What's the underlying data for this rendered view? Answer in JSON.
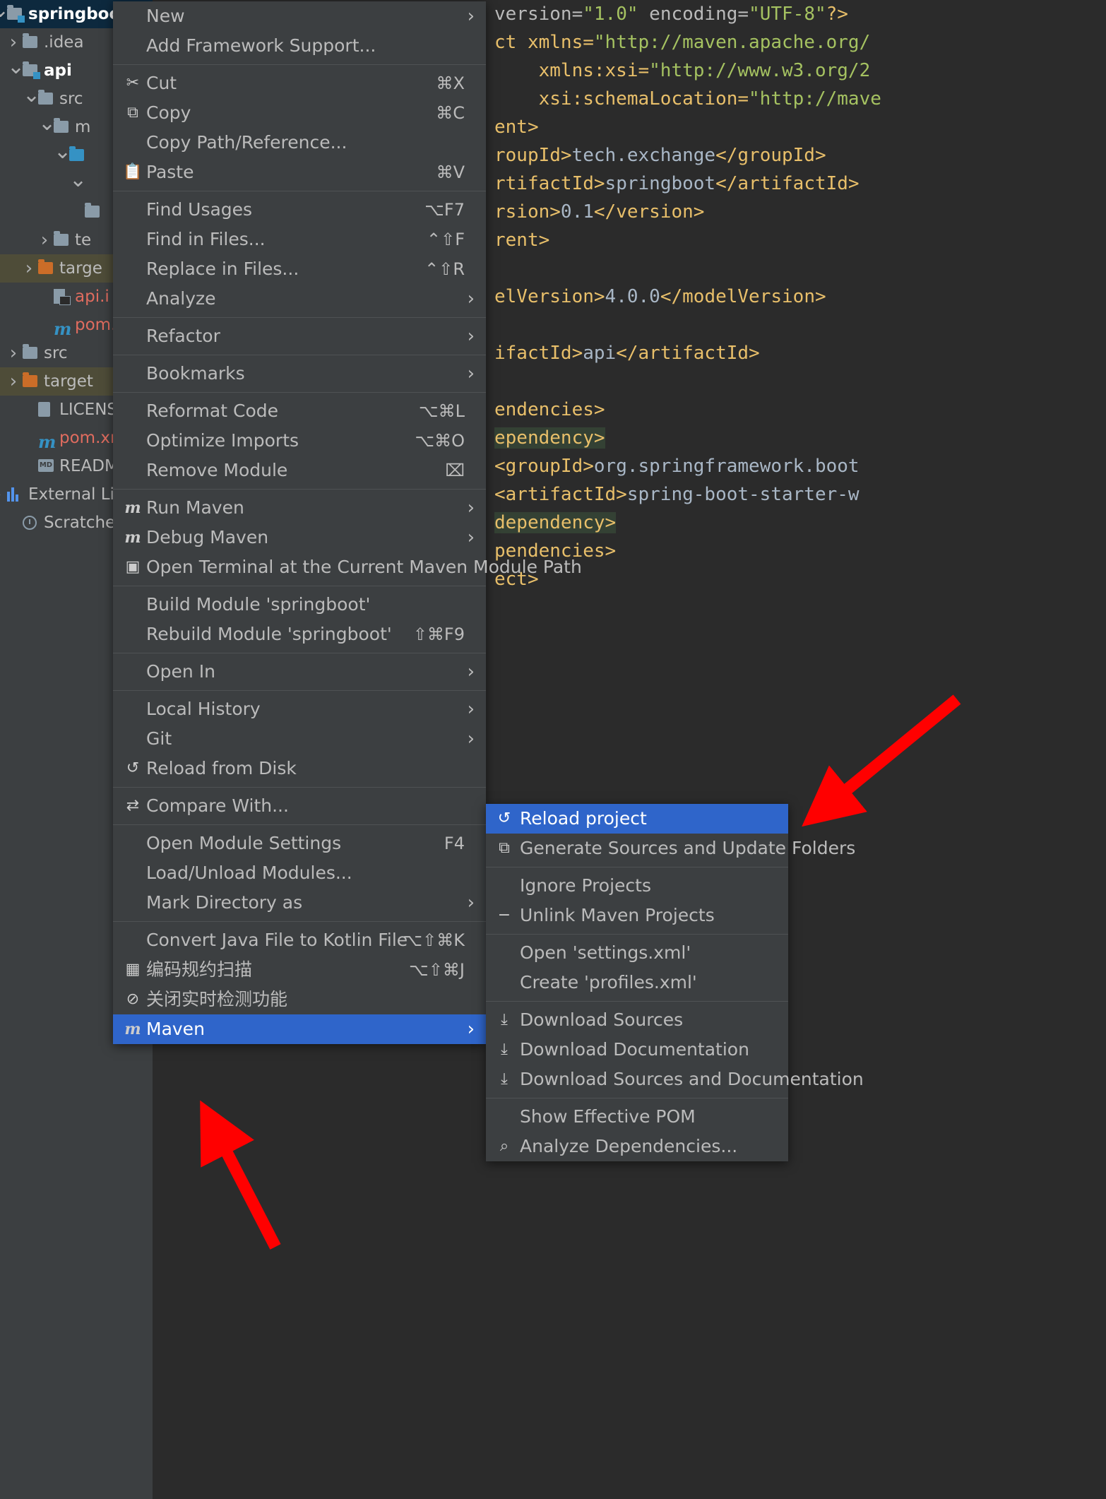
{
  "app": {
    "theme_bg": "#3c3f41",
    "editor_bg": "#2b2b2b",
    "accent": "#2f65ca",
    "annotation_color": "#ff0000"
  },
  "sidebar": {
    "items": [
      {
        "label": "springboot",
        "icon": "module-folder-icon",
        "indent": 0,
        "arrow": "v",
        "state": "selected-blue",
        "bold": true
      },
      {
        "label": ".idea",
        "icon": "folder-icon",
        "indent": 1,
        "arrow": ">",
        "state": "",
        "bold": false
      },
      {
        "label": "api",
        "icon": "module-folder-icon",
        "indent": 1,
        "arrow": "v",
        "state": "",
        "bold": true
      },
      {
        "label": "src",
        "icon": "folder-icon",
        "indent": 2,
        "arrow": "v",
        "state": "",
        "bold": false
      },
      {
        "label": "m",
        "icon": "folder-icon",
        "indent": 3,
        "arrow": "v",
        "state": "",
        "bold": false
      },
      {
        "label": "",
        "icon": "source-folder-icon",
        "indent": 4,
        "arrow": "v",
        "state": "",
        "bold": false
      },
      {
        "label": "",
        "icon": "",
        "indent": 5,
        "arrow": "v",
        "state": "",
        "bold": false
      },
      {
        "label": "",
        "icon": "folder-icon",
        "indent": 5,
        "arrow": "",
        "state": "",
        "bold": false
      },
      {
        "label": "te",
        "icon": "folder-icon",
        "indent": 3,
        "arrow": ">",
        "state": "",
        "bold": false
      },
      {
        "label": "targe",
        "icon": "excluded-folder-icon",
        "indent": 2,
        "arrow": ">",
        "state": "selected-olive",
        "bold": false
      },
      {
        "label": "api.i",
        "icon": "iml-file-icon",
        "indent": 3,
        "arrow": "",
        "state": "",
        "bold": false,
        "color": "red"
      },
      {
        "label": "pom.",
        "icon": "maven-file-icon",
        "indent": 3,
        "arrow": "",
        "state": "",
        "bold": false,
        "color": "red"
      },
      {
        "label": "src",
        "icon": "folder-icon",
        "indent": 1,
        "arrow": ">",
        "state": "",
        "bold": false
      },
      {
        "label": "target",
        "icon": "excluded-folder-icon",
        "indent": 1,
        "arrow": ">",
        "state": "selected-olive",
        "bold": false
      },
      {
        "label": "LICENSE",
        "icon": "file-icon",
        "indent": 2,
        "arrow": "",
        "state": "",
        "bold": false
      },
      {
        "label": "pom.xm",
        "icon": "maven-file-icon",
        "indent": 2,
        "arrow": "",
        "state": "",
        "bold": false,
        "color": "red"
      },
      {
        "label": "README",
        "icon": "markdown-file-icon",
        "indent": 2,
        "arrow": "",
        "state": "",
        "bold": false
      },
      {
        "label": "External Li",
        "icon": "library-icon",
        "indent": 0,
        "arrow": ">",
        "state": "",
        "bold": false
      },
      {
        "label": "Scratches a",
        "icon": "scratches-icon",
        "indent": 1,
        "arrow": "",
        "state": "",
        "bold": false
      }
    ]
  },
  "editor": {
    "lines": [
      {
        "segments": [
          {
            "t": "version=",
            "c": "attr"
          },
          {
            "t": "\"1.0\"",
            "c": "str"
          },
          {
            "t": " encoding=",
            "c": "attr"
          },
          {
            "t": "\"UTF-8\"",
            "c": "str"
          },
          {
            "t": "?>",
            "c": "tag"
          }
        ]
      },
      {
        "segments": [
          {
            "t": "ct xmlns=",
            "c": "tag"
          },
          {
            "t": "\"http://maven.apache.org/",
            "c": "str"
          }
        ]
      },
      {
        "segments": [
          {
            "t": "    xmlns:xsi=",
            "c": "tag"
          },
          {
            "t": "\"http://www.w3.org/2",
            "c": "str"
          }
        ]
      },
      {
        "segments": [
          {
            "t": "    xsi:schemaLocation=",
            "c": "tag"
          },
          {
            "t": "\"http://mave",
            "c": "str"
          }
        ]
      },
      {
        "segments": [
          {
            "t": "ent>",
            "c": "tag"
          }
        ]
      },
      {
        "segments": [
          {
            "t": "roupId>",
            "c": "tag"
          },
          {
            "t": "tech.exchange",
            "c": "txt"
          },
          {
            "t": "</groupId>",
            "c": "tag"
          }
        ]
      },
      {
        "segments": [
          {
            "t": "rtifactId>",
            "c": "tag"
          },
          {
            "t": "springboot",
            "c": "txt"
          },
          {
            "t": "</artifactId>",
            "c": "tag"
          }
        ]
      },
      {
        "segments": [
          {
            "t": "rsion>",
            "c": "tag"
          },
          {
            "t": "0.1",
            "c": "txt"
          },
          {
            "t": "</version>",
            "c": "tag"
          }
        ]
      },
      {
        "segments": [
          {
            "t": "rent>",
            "c": "tag"
          }
        ]
      },
      {
        "segments": []
      },
      {
        "segments": [
          {
            "t": "elVersion>",
            "c": "tag"
          },
          {
            "t": "4.0.0",
            "c": "txt"
          },
          {
            "t": "</modelVersion>",
            "c": "tag"
          }
        ]
      },
      {
        "segments": []
      },
      {
        "segments": [
          {
            "t": "ifactId>",
            "c": "tag"
          },
          {
            "t": "api",
            "c": "txt"
          },
          {
            "t": "</artifactId>",
            "c": "tag"
          }
        ]
      },
      {
        "segments": []
      },
      {
        "segments": [
          {
            "t": "endencies>",
            "c": "tag"
          }
        ]
      },
      {
        "segments": [
          {
            "t": "ependency>",
            "c": "tag",
            "hl": true
          }
        ]
      },
      {
        "segments": [
          {
            "t": "<groupId>",
            "c": "tag"
          },
          {
            "t": "org.springframework.boot",
            "c": "txt"
          }
        ]
      },
      {
        "segments": [
          {
            "t": "<artifactId>",
            "c": "tag"
          },
          {
            "t": "spring-boot-starter-w",
            "c": "txt"
          }
        ]
      },
      {
        "segments": [
          {
            "t": "dependency>",
            "c": "tag",
            "hl": true
          }
        ]
      },
      {
        "segments": [
          {
            "t": "pendencies>",
            "c": "tag"
          }
        ]
      },
      {
        "segments": [
          {
            "t": "ect>",
            "c": "tag"
          }
        ]
      }
    ]
  },
  "context_menu": {
    "groups": [
      {
        "items": [
          {
            "label": "New",
            "shortcut": "",
            "submenu": true,
            "icon": ""
          },
          {
            "label": "Add Framework Support...",
            "shortcut": "",
            "submenu": false,
            "icon": ""
          }
        ]
      },
      {
        "items": [
          {
            "label": "Cut",
            "shortcut": "⌘X",
            "submenu": false,
            "icon": "scissors-icon"
          },
          {
            "label": "Copy",
            "shortcut": "⌘C",
            "submenu": false,
            "icon": "copy-icon"
          },
          {
            "label": "Copy Path/Reference...",
            "shortcut": "",
            "submenu": false,
            "icon": ""
          },
          {
            "label": "Paste",
            "shortcut": "⌘V",
            "submenu": false,
            "icon": "clipboard-icon"
          }
        ]
      },
      {
        "items": [
          {
            "label": "Find Usages",
            "shortcut": "⌥F7",
            "submenu": false,
            "icon": ""
          },
          {
            "label": "Find in Files...",
            "shortcut": "⌃⇧F",
            "submenu": false,
            "icon": ""
          },
          {
            "label": "Replace in Files...",
            "shortcut": "⌃⇧R",
            "submenu": false,
            "icon": ""
          },
          {
            "label": "Analyze",
            "shortcut": "",
            "submenu": true,
            "icon": ""
          }
        ]
      },
      {
        "items": [
          {
            "label": "Refactor",
            "shortcut": "",
            "submenu": true,
            "icon": ""
          }
        ]
      },
      {
        "items": [
          {
            "label": "Bookmarks",
            "shortcut": "",
            "submenu": true,
            "icon": ""
          }
        ]
      },
      {
        "items": [
          {
            "label": "Reformat Code",
            "shortcut": "⌥⌘L",
            "submenu": false,
            "icon": ""
          },
          {
            "label": "Optimize Imports",
            "shortcut": "⌥⌘O",
            "submenu": false,
            "icon": ""
          },
          {
            "label": "Remove Module",
            "shortcut": "⌧",
            "submenu": false,
            "icon": ""
          }
        ]
      },
      {
        "items": [
          {
            "label": "Run Maven",
            "shortcut": "",
            "submenu": true,
            "icon": "maven-icon"
          },
          {
            "label": "Debug Maven",
            "shortcut": "",
            "submenu": true,
            "icon": "maven-debug-icon"
          },
          {
            "label": "Open Terminal at the Current Maven Module Path",
            "shortcut": "",
            "submenu": false,
            "icon": "terminal-icon"
          }
        ]
      },
      {
        "items": [
          {
            "label": "Build Module 'springboot'",
            "shortcut": "",
            "submenu": false,
            "icon": ""
          },
          {
            "label": "Rebuild Module 'springboot'",
            "shortcut": "⇧⌘F9",
            "submenu": false,
            "icon": ""
          }
        ]
      },
      {
        "items": [
          {
            "label": "Open In",
            "shortcut": "",
            "submenu": true,
            "icon": ""
          }
        ]
      },
      {
        "items": [
          {
            "label": "Local History",
            "shortcut": "",
            "submenu": true,
            "icon": ""
          },
          {
            "label": "Git",
            "shortcut": "",
            "submenu": true,
            "icon": ""
          },
          {
            "label": "Reload from Disk",
            "shortcut": "",
            "submenu": false,
            "icon": "reload-icon"
          }
        ]
      },
      {
        "items": [
          {
            "label": "Compare With...",
            "shortcut": "",
            "submenu": false,
            "icon": "compare-icon"
          }
        ]
      },
      {
        "items": [
          {
            "label": "Open Module Settings",
            "shortcut": "F4",
            "submenu": false,
            "icon": ""
          },
          {
            "label": "Load/Unload Modules...",
            "shortcut": "",
            "submenu": false,
            "icon": ""
          },
          {
            "label": "Mark Directory as",
            "shortcut": "",
            "submenu": true,
            "icon": ""
          }
        ]
      },
      {
        "items": [
          {
            "label": "Convert Java File to Kotlin File",
            "shortcut": "⌥⇧⌘K",
            "submenu": false,
            "icon": ""
          },
          {
            "label": "编码规约扫描",
            "shortcut": "⌥⇧⌘J",
            "submenu": false,
            "icon": "scan-icon"
          },
          {
            "label": "关闭实时检测功能",
            "shortcut": "",
            "submenu": false,
            "icon": "disable-icon"
          },
          {
            "label": "Maven",
            "shortcut": "",
            "submenu": true,
            "icon": "maven-icon",
            "highlighted": true
          }
        ]
      }
    ]
  },
  "submenu": {
    "groups": [
      {
        "items": [
          {
            "label": "Reload project",
            "icon": "reload-icon",
            "highlighted": true
          },
          {
            "label": "Generate Sources and Update Folders",
            "icon": "generate-sources-icon",
            "highlighted": false
          }
        ]
      },
      {
        "items": [
          {
            "label": "Ignore Projects",
            "icon": "",
            "highlighted": false
          },
          {
            "label": "Unlink Maven Projects",
            "icon": "minus-icon",
            "highlighted": false
          }
        ]
      },
      {
        "items": [
          {
            "label": "Open 'settings.xml'",
            "icon": "",
            "highlighted": false
          },
          {
            "label": "Create 'profiles.xml'",
            "icon": "",
            "highlighted": false
          }
        ]
      },
      {
        "items": [
          {
            "label": "Download Sources",
            "icon": "download-icon",
            "highlighted": false
          },
          {
            "label": "Download Documentation",
            "icon": "download-icon",
            "highlighted": false
          },
          {
            "label": "Download Sources and Documentation",
            "icon": "download-icon",
            "highlighted": false
          }
        ]
      },
      {
        "items": [
          {
            "label": "Show Effective POM",
            "icon": "",
            "highlighted": false
          },
          {
            "label": "Analyze Dependencies...",
            "icon": "search-icon",
            "highlighted": false
          }
        ]
      }
    ]
  }
}
